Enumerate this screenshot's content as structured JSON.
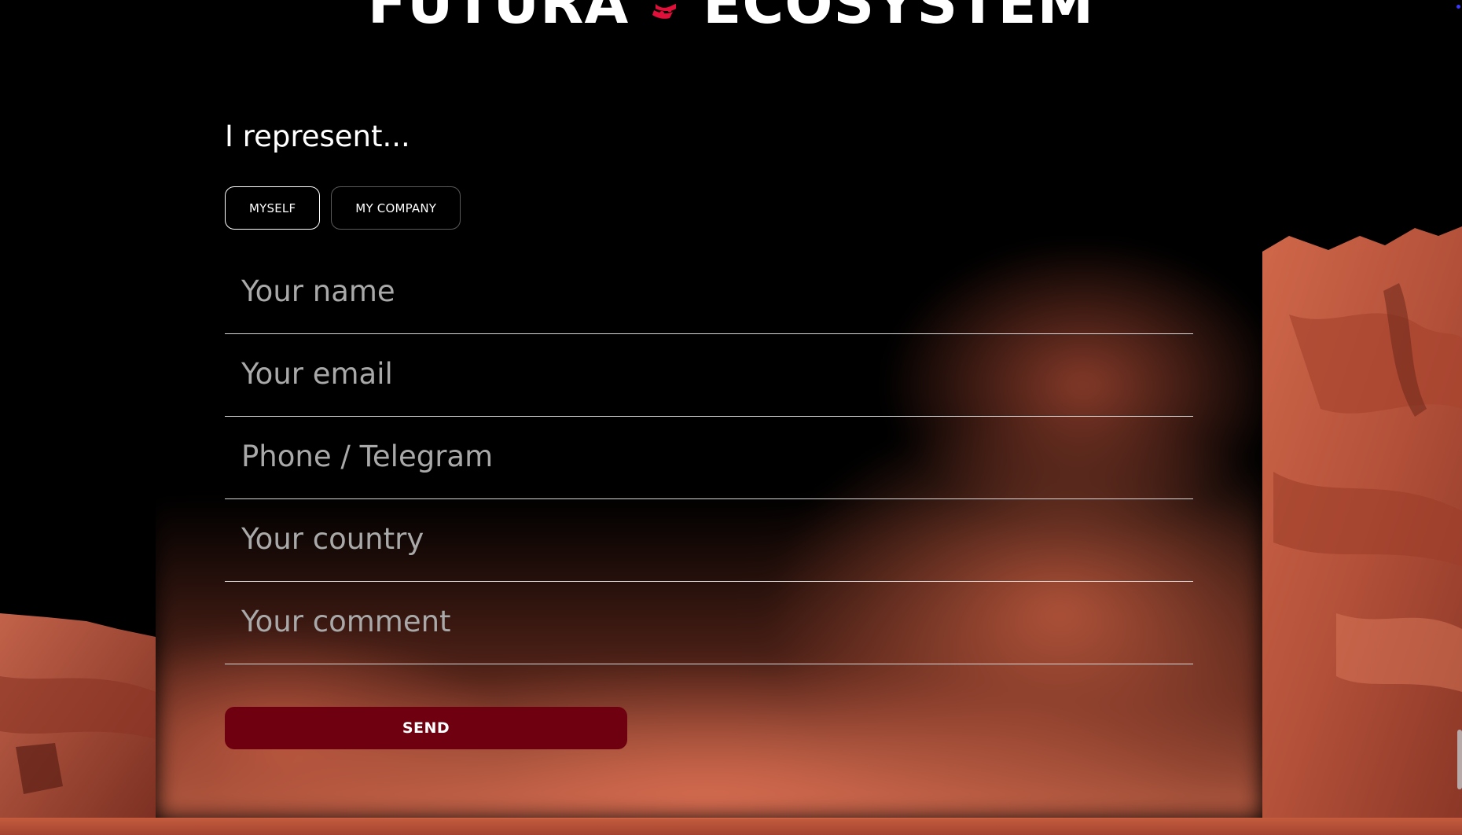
{
  "header": {
    "title_left": "FUTURA",
    "title_right": "ECOSYSTEM",
    "logo_icon": "red-flower-logo-icon"
  },
  "form": {
    "heading": "I represent...",
    "toggle": {
      "options": [
        "MYSELF",
        "MY COMPANY"
      ],
      "selected": "MYSELF"
    },
    "fields": {
      "name_placeholder": "Your name",
      "email_placeholder": "Your email",
      "phone_placeholder": "Phone / Telegram",
      "country_placeholder": "Your country",
      "comment_placeholder": "Your comment"
    },
    "submit_label": "SEND"
  },
  "colors": {
    "background": "#000000",
    "accent": "#e0103a",
    "submit_button": "#6e0010",
    "field_underline": "#d8d8d8",
    "placeholder": "#a9a9a9",
    "terrain": "#c8603e"
  }
}
